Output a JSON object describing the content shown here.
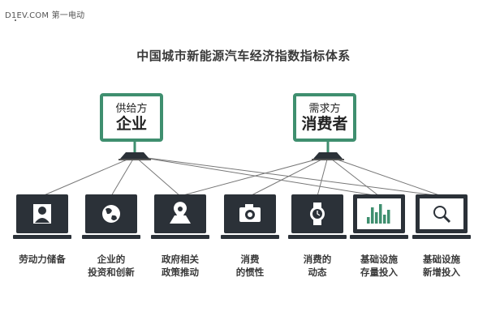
{
  "watermark": "D1EV.COM 第一电动",
  "title": "中国城市新能源汽车经济指数指标体系",
  "top_nodes": [
    {
      "line1": "供给方",
      "line2": "企业"
    },
    {
      "line1": "需求方",
      "line2": "消费者"
    }
  ],
  "bottom_nodes": [
    {
      "icon": "person-icon",
      "lines": [
        "劳动力储备"
      ]
    },
    {
      "icon": "globe-icon",
      "lines": [
        "企业的",
        "投资和创新"
      ]
    },
    {
      "icon": "map-pin-icon",
      "lines": [
        "政府相关",
        "政策推动"
      ]
    },
    {
      "icon": "camera-icon",
      "lines": [
        "消费",
        "的惯性"
      ]
    },
    {
      "icon": "watch-icon",
      "lines": [
        "消费的",
        "动态"
      ]
    },
    {
      "icon": "bar-chart-icon",
      "lines": [
        "基础设施",
        "存量投入"
      ]
    },
    {
      "icon": "magnifier-icon",
      "lines": [
        "基础设施",
        "新增投入"
      ]
    }
  ],
  "colors": {
    "frame": "#3f8f6f",
    "monitor": "#2b3138",
    "connector": "#777777"
  }
}
